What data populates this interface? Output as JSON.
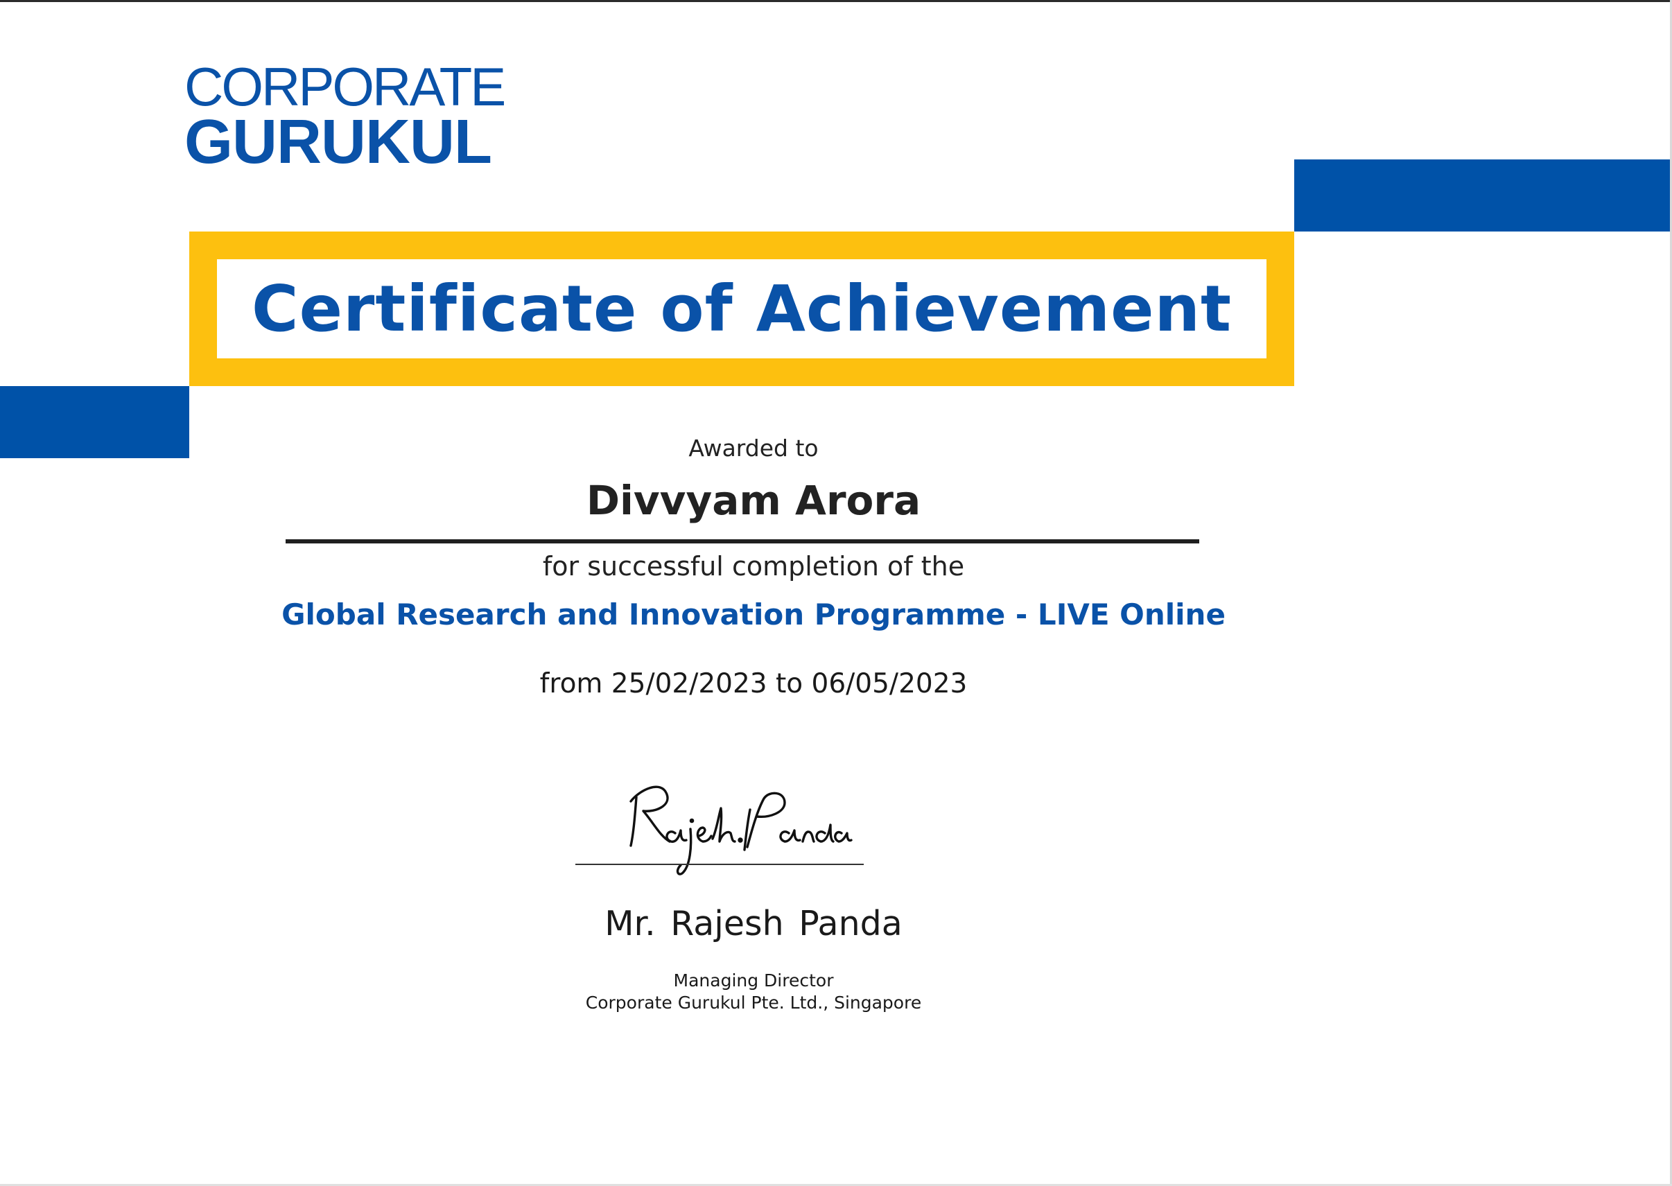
{
  "logo": {
    "line1": "CORPORATE",
    "line2": "GURUKUL"
  },
  "certificate": {
    "title": "Certificate of Achievement",
    "awarded_label": "Awarded to",
    "recipient": "Divvyam Arora",
    "completion_text": "for successful completion of the",
    "programme": "Global Research and Innovation Programme - LIVE Online",
    "dates": "from 25/02/2023 to 06/05/2023"
  },
  "signatory": {
    "signature_text": "Rajesh Panda",
    "name": "Mr. Rajesh Panda",
    "role": "Managing Director",
    "company": "Corporate Gurukul Pte. Ltd., Singapore"
  },
  "colors": {
    "brand_blue": "#0052a8",
    "accent_yellow": "#fdc00f",
    "text": "#1f1f1f"
  }
}
